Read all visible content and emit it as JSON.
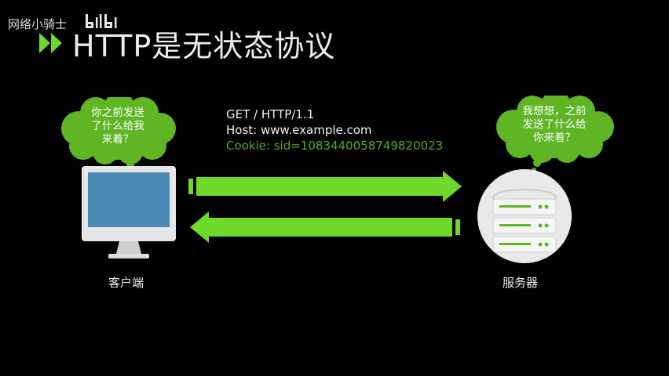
{
  "watermark": {
    "text": "网络小骑士",
    "logo": "bilibili-logo"
  },
  "title": {
    "text": "HTTP是无状态协议",
    "icon": "double-chevron-right-icon"
  },
  "request": {
    "line1": "GET / HTTP/1.1",
    "line2": "Host: www.example.com",
    "line3": "Cookie: sid=1083440058749820023"
  },
  "client": {
    "label": "客户端",
    "bubble": "你之前发送\n了什么给我\n来着？"
  },
  "server": {
    "label": "服务器",
    "bubble": "我想想，之前\n发送了什么给\n你来着？"
  },
  "colors": {
    "arrow": "#6fd82a",
    "cloud": "#5fb524",
    "screen": "#4b8ab5",
    "background": "#000000"
  }
}
